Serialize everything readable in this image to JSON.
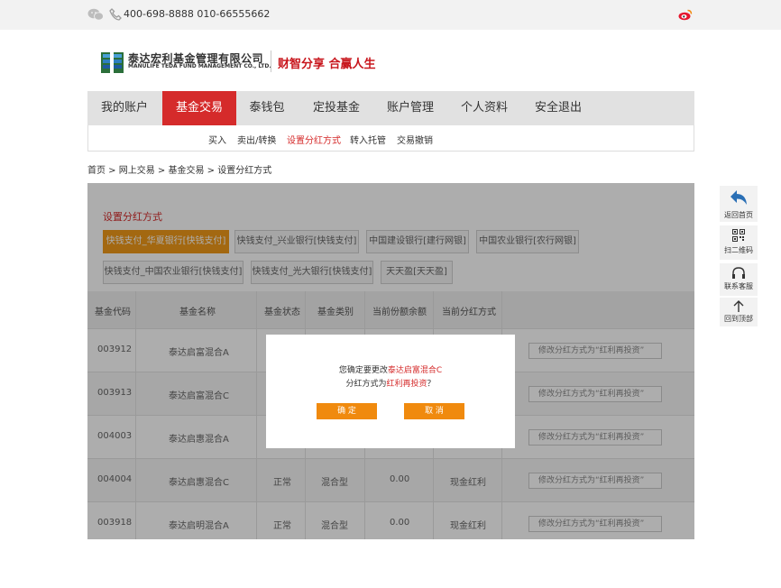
{
  "topbar": {
    "phones": "400-698-8888 010-66555662",
    "icons": [
      "wechat-icon",
      "phone-icon",
      "weibo-icon"
    ]
  },
  "brand": {
    "name_cn": "泰达宏利基金管理有限公司",
    "name_en": "MANULIFE TEDA FUND MANAGEMENT CO., LTD.",
    "slogan": "财智分享  合赢人生"
  },
  "nav": {
    "items": [
      "我的账户",
      "基金交易",
      "泰钱包",
      "定投基金",
      "账户管理",
      "个人资料",
      "安全退出"
    ],
    "active": "基金交易"
  },
  "subnav": {
    "items": [
      "买入",
      "卖出/转换",
      "设置分红方式",
      "转入托管",
      "交易撤销"
    ],
    "active": "设置分红方式"
  },
  "breadcrumb": "首页 > 网上交易 > 基金交易 > 设置分红方式",
  "panel": {
    "title": "设置分红方式",
    "banks": [
      "快钱支付_华夏银行[快钱支付]",
      "快钱支付_兴业银行[快钱支付]",
      "中国建设银行[建行网银]",
      "中国农业银行[农行网银]",
      "快钱支付_中国农业银行[快钱支付]",
      "快钱支付_光大银行[快钱支付]",
      "天天盈[天天盈]"
    ],
    "selected_bank": "快钱支付_华夏银行[快钱支付]",
    "columns": [
      "基金代码",
      "基金名称",
      "基金状态",
      "基金类别",
      "当前份额余额",
      "当前分红方式"
    ],
    "rows": [
      {
        "code": "003912",
        "name": "泰达启富混合A",
        "status": "",
        "type": "",
        "balance": "",
        "method": "",
        "action": "修改分红方式为“红利再投资”"
      },
      {
        "code": "003913",
        "name": "泰达启富混合C",
        "status": "",
        "type": "",
        "balance": "",
        "method": "",
        "action": "修改分红方式为“红利再投资”"
      },
      {
        "code": "004003",
        "name": "泰达启惠混合A",
        "status": "",
        "type": "",
        "balance": "",
        "method": "",
        "action": "修改分红方式为“红利再投资”"
      },
      {
        "code": "004004",
        "name": "泰达启惠混合C",
        "status": "正常",
        "type": "混合型",
        "balance": "0.00",
        "method": "现金红利",
        "action": "修改分红方式为“红利再投资”"
      },
      {
        "code": "003918",
        "name": "泰达启明混合A",
        "status": "正常",
        "type": "混合型",
        "balance": "0.00",
        "method": "现金红利",
        "action": "修改分红方式为“红利再投资”"
      }
    ]
  },
  "sidetools": [
    {
      "icon": "back-arrow-icon",
      "label": "返回首页"
    },
    {
      "icon": "qr-code-icon",
      "label": "扫二维码"
    },
    {
      "icon": "headset-icon",
      "label": "联系客服"
    },
    {
      "icon": "arrow-up-icon",
      "label": "回到顶部"
    }
  ],
  "modal": {
    "line1_prefix": "您确定要更改",
    "line1_fund": "泰达启富混合C",
    "line2_prefix": "分红方式为",
    "line2_method": "红利再投资",
    "line2_suffix": "？",
    "confirm_label": "确 定",
    "cancel_label": "取 消"
  },
  "colors": {
    "accent_red": "#d52b2b",
    "orange": "#f08a0e",
    "selected_bank": "#f09a1a"
  }
}
